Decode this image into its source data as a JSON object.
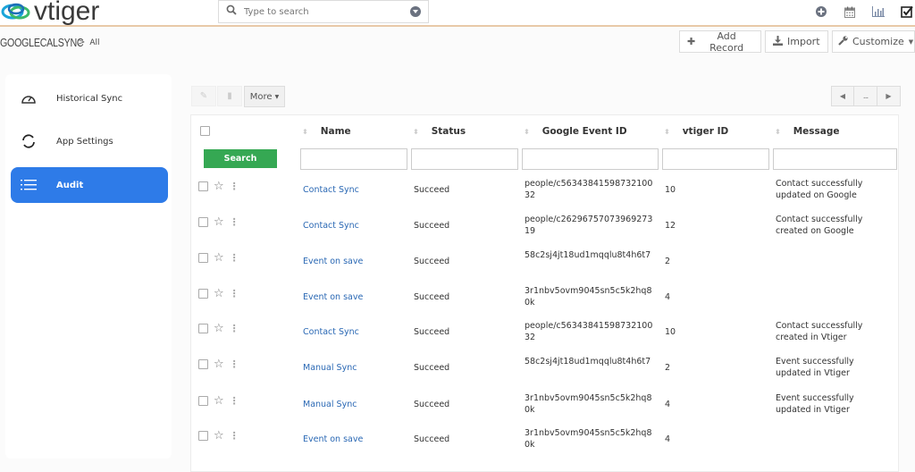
{
  "app": {
    "logo_text": "vtiger",
    "brand_color": "#2e7be8"
  },
  "search": {
    "placeholder": "Type to search"
  },
  "top_icons": [
    "plus-circle-icon",
    "calendar-icon",
    "chart-icon",
    "checkbox-icon"
  ],
  "breadcrumb": {
    "module": "GOOGLECALSYNC",
    "separator": ">",
    "view": "All"
  },
  "actions": {
    "add_record": "Add Record",
    "import": "Import",
    "customize": "Customize"
  },
  "sidebar": {
    "items": [
      {
        "label": "Historical Sync",
        "icon": "gauge-icon",
        "active": false
      },
      {
        "label": "App Settings",
        "icon": "sync-icon",
        "active": false
      },
      {
        "label": "Audit",
        "icon": "list-icon",
        "active": true
      }
    ]
  },
  "toolbar": {
    "more_label": "More",
    "pager_more": "..."
  },
  "table": {
    "columns": [
      "Name",
      "Status",
      "Google Event ID",
      "vtiger ID",
      "Message"
    ],
    "search_label": "Search",
    "rows": [
      {
        "name": "Contact Sync",
        "status": "Succeed",
        "google_event_id": "people/c5634384159873210032",
        "vtiger_id": "10",
        "message": "Contact successfully updated on Google"
      },
      {
        "name": "Contact Sync",
        "status": "Succeed",
        "google_event_id": "people/c2629675707396927319",
        "vtiger_id": "12",
        "message": "Contact successfully created on Google"
      },
      {
        "name": "Event on save",
        "status": "Succeed",
        "google_event_id": "58c2sj4jt18ud1mqqlu8t4h6t7",
        "vtiger_id": "2",
        "message": ""
      },
      {
        "name": "Event on save",
        "status": "Succeed",
        "google_event_id": "3r1nbv5ovm9045sn5c5k2hq80k",
        "vtiger_id": "4",
        "message": ""
      },
      {
        "name": "Contact Sync",
        "status": "Succeed",
        "google_event_id": "people/c5634384159873210032",
        "vtiger_id": "10",
        "message": "Contact successfully created in Vtiger"
      },
      {
        "name": "Manual Sync",
        "status": "Succeed",
        "google_event_id": "58c2sj4jt18ud1mqqlu8t4h6t7",
        "vtiger_id": "2",
        "message": "Event successfully updated in Vtiger"
      },
      {
        "name": "Manual Sync",
        "status": "Succeed",
        "google_event_id": "3r1nbv5ovm9045sn5c5k2hq80k",
        "vtiger_id": "4",
        "message": "Event successfully updated in Vtiger"
      },
      {
        "name": "Event on save",
        "status": "Succeed",
        "google_event_id": "3r1nbv5ovm9045sn5c5k2hq80k",
        "vtiger_id": "4",
        "message": ""
      }
    ]
  }
}
